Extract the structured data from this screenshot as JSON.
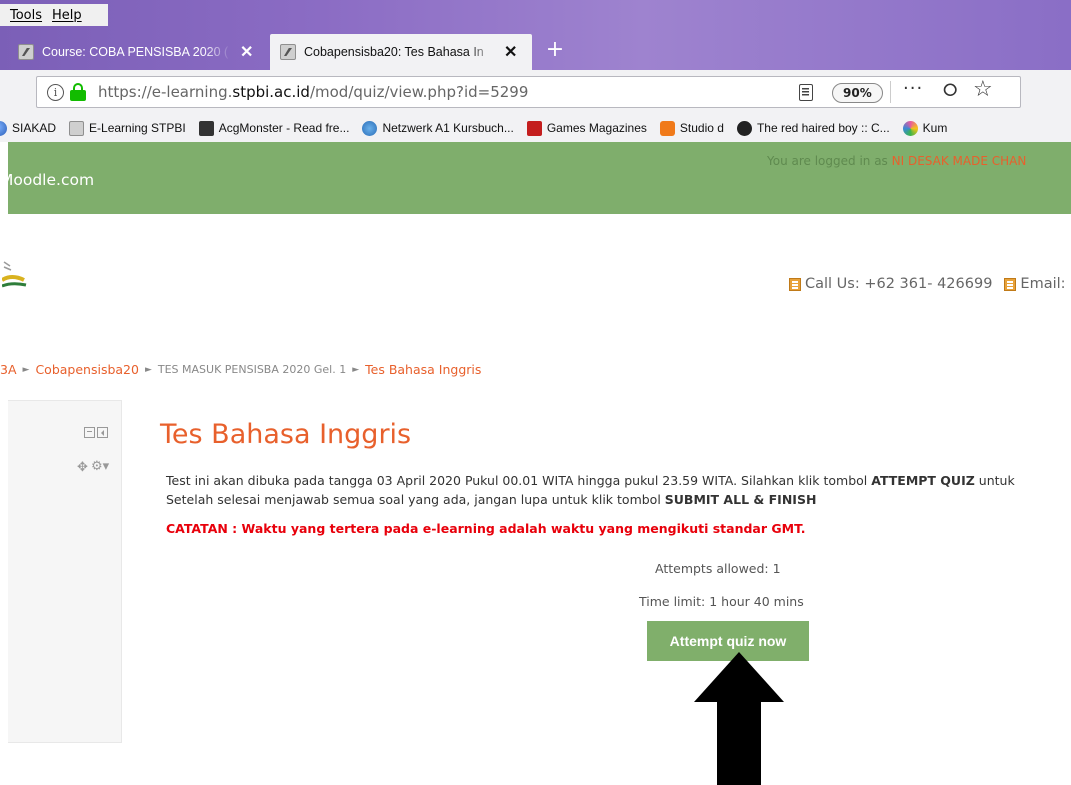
{
  "browser": {
    "menu": [
      "Tools",
      "Help"
    ],
    "tabs": [
      {
        "title": "Course: COBA PENSISBA 2020 (",
        "active": false
      },
      {
        "title": "Cobapensisba20: Tes Bahasa In",
        "active": true
      }
    ],
    "new_tab": "+",
    "url_prefix": "https://e-learning.",
    "url_domain": "stpbi.ac.id",
    "url_suffix": "/mod/quiz/view.php?id=5299",
    "zoom": "90%",
    "more_icon": "···",
    "bookmarks": [
      {
        "label": "SIAKAD",
        "icon": "globe-icon",
        "color": "#4a7bd0"
      },
      {
        "label": "E-Learning STPBI",
        "icon": "moodle-icon",
        "color": "#bdbdbd"
      },
      {
        "label": "AcgMonster - Read fre...",
        "icon": "acg-icon",
        "color": "#333333"
      },
      {
        "label": "Netzwerk A1 Kursbuch...",
        "icon": "netzwerk-icon",
        "color": "#3a8ad6"
      },
      {
        "label": "Games Magazines",
        "icon": "magazine-icon",
        "color": "#c41e1e"
      },
      {
        "label": "Studio d",
        "icon": "blogger-icon",
        "color": "#f07a1a"
      },
      {
        "label": "The red haired boy :: C...",
        "icon": "face-icon",
        "color": "#222222"
      },
      {
        "label": "Kum",
        "icon": "flower-icon",
        "color": "#e85aa0"
      }
    ]
  },
  "header": {
    "site_name": "Moodle.com",
    "login_prefix": "You are logged in as ",
    "login_user": "NI DESAK MADE CHAN",
    "call_us": "Call Us: +62 361- 426699",
    "email": "Email:"
  },
  "breadcrumb": {
    "item1": "3A",
    "item2": "Cobapensisba20",
    "item3": "TES MASUK PENSISBA 2020 Gel. 1",
    "item4": "Tes Bahasa Inggris",
    "separator": "►"
  },
  "quiz": {
    "title": "Tes Bahasa Inggris",
    "line1_text": "Test ini akan dibuka pada tangga 03 April 2020 Pukul 00.01 WITA hingga pukul 23.59 WITA. Silahkan klik tombol ",
    "line1_bold": "ATTEMPT QUIZ",
    "line1_end": " untuk",
    "line2_text": "Setelah selesai menjawab semua soal yang ada, jangan lupa untuk klik tombol ",
    "line2_bold": "SUBMIT ALL & FINISH",
    "catatan": "CATATAN : Waktu yang tertera pada e-learning adalah waktu yang mengikuti standar GMT.",
    "attempts_allowed": "Attempts allowed: 1",
    "time_limit": "Time limit: 1 hour 40 mins",
    "attempt_button": "Attempt quiz now"
  },
  "colors": {
    "accent_orange": "#e8602c",
    "header_green": "#7fae6c",
    "button_green": "#80af6b",
    "warning_red": "#e8000b",
    "titlebar_purple": "#8b6cc4"
  }
}
